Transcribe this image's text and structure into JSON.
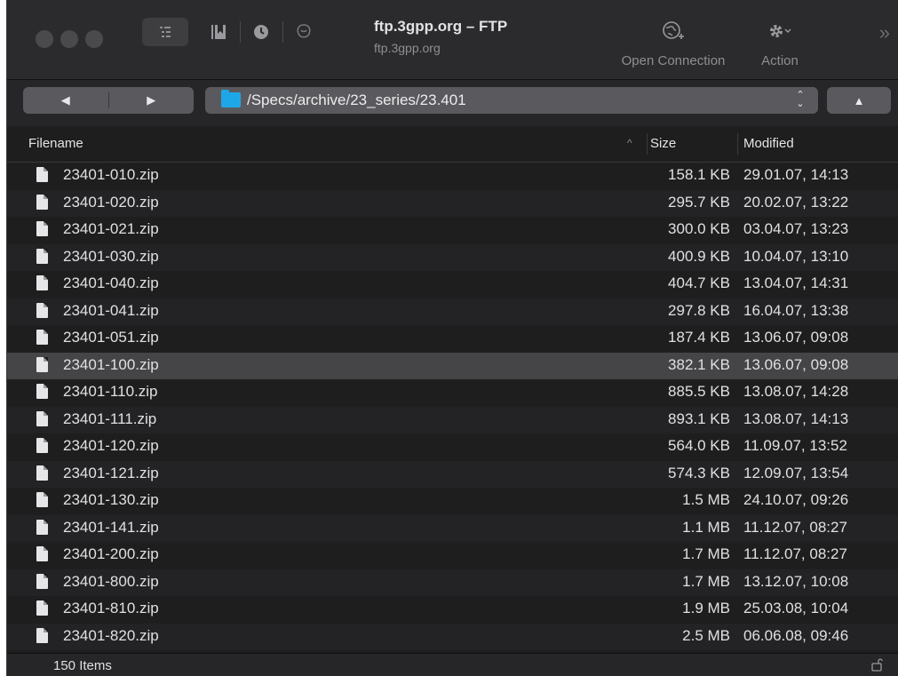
{
  "window": {
    "title": "ftp.3gpp.org – FTP",
    "subtitle": "ftp.3gpp.org"
  },
  "toolbar": {
    "items": [
      {
        "icon": "globe-plus-icon",
        "label": "Open Connection"
      },
      {
        "icon": "gear-icon",
        "label": "Action"
      }
    ],
    "toggle_icon": "outline-toggle-icon",
    "bookmarks_icon": "bookmarks-icon",
    "history_icon": "history-clock-icon",
    "bonjour_icon": "bonjour-icon",
    "overflow_icon": "overflow-chevron-icon"
  },
  "pathbar": {
    "path": "/Specs/archive/23_series/23.401",
    "back_icon": "back-triangle-icon",
    "forward_icon": "forward-triangle-icon",
    "up_icon": "up-triangle-icon"
  },
  "columns": {
    "filename": "Filename",
    "size": "Size",
    "modified": "Modified"
  },
  "files": [
    {
      "name": "23401-010.zip",
      "size": "158.1 KB",
      "modified": "29.01.07, 14:13"
    },
    {
      "name": "23401-020.zip",
      "size": "295.7 KB",
      "modified": "20.02.07, 13:22"
    },
    {
      "name": "23401-021.zip",
      "size": "300.0 KB",
      "modified": "03.04.07, 13:23"
    },
    {
      "name": "23401-030.zip",
      "size": "400.9 KB",
      "modified": "10.04.07, 13:10"
    },
    {
      "name": "23401-040.zip",
      "size": "404.7 KB",
      "modified": "13.04.07, 14:31"
    },
    {
      "name": "23401-041.zip",
      "size": "297.8 KB",
      "modified": "16.04.07, 13:38"
    },
    {
      "name": "23401-051.zip",
      "size": "187.4 KB",
      "modified": "13.06.07, 09:08"
    },
    {
      "name": "23401-100.zip",
      "size": "382.1 KB",
      "modified": "13.06.07, 09:08",
      "selected": true
    },
    {
      "name": "23401-110.zip",
      "size": "885.5 KB",
      "modified": "13.08.07, 14:28"
    },
    {
      "name": "23401-111.zip",
      "size": "893.1 KB",
      "modified": "13.08.07, 14:13"
    },
    {
      "name": "23401-120.zip",
      "size": "564.0 KB",
      "modified": "11.09.07, 13:52"
    },
    {
      "name": "23401-121.zip",
      "size": "574.3 KB",
      "modified": "12.09.07, 13:54"
    },
    {
      "name": "23401-130.zip",
      "size": "1.5 MB",
      "modified": "24.10.07, 09:26"
    },
    {
      "name": "23401-141.zip",
      "size": "1.1 MB",
      "modified": "11.12.07, 08:27"
    },
    {
      "name": "23401-200.zip",
      "size": "1.7 MB",
      "modified": "11.12.07, 08:27"
    },
    {
      "name": "23401-800.zip",
      "size": "1.7 MB",
      "modified": "13.12.07, 10:08"
    },
    {
      "name": "23401-810.zip",
      "size": "1.9 MB",
      "modified": "25.03.08, 10:04"
    },
    {
      "name": "23401-820.zip",
      "size": "2.5 MB",
      "modified": "06.06.08, 09:46"
    }
  ],
  "status": {
    "count": "150 Items",
    "lock_icon": "unlocked-padlock-icon"
  }
}
